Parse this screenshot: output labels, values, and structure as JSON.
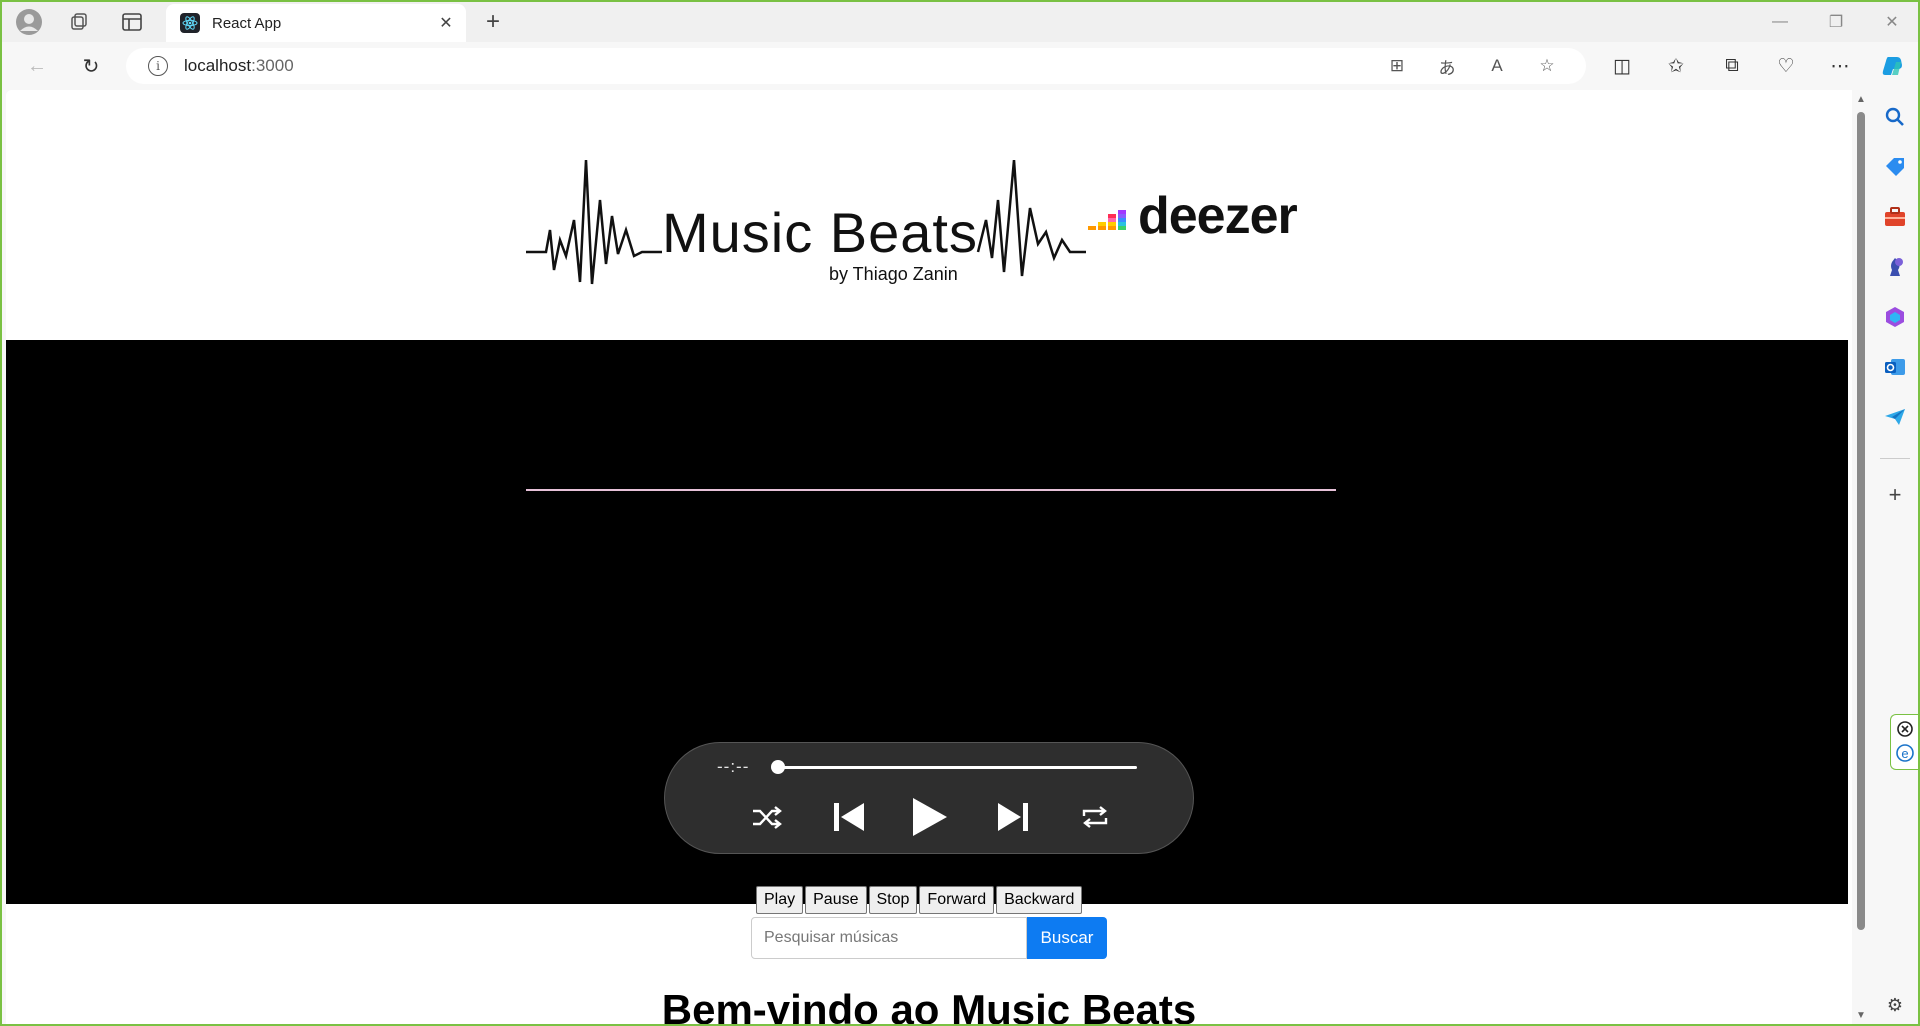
{
  "browser": {
    "tab_title": "React App",
    "url_host": "localhost",
    "url_port": ":3000",
    "accent_color": "#7ac143"
  },
  "page": {
    "logo": {
      "brand": "Music Beats",
      "byline": "by Thiago Zanin",
      "partner": "deezer"
    },
    "player": {
      "time": "--:--",
      "progress": 0
    },
    "legacy_buttons": {
      "play": "Play",
      "pause": "Pause",
      "stop": "Stop",
      "forward": "Forward",
      "backward": "Backward"
    },
    "search": {
      "placeholder": "Pesquisar músicas",
      "button": "Buscar",
      "button_color": "#0d7bf2"
    },
    "welcome": "Bem-vindo ao Music Beats"
  }
}
